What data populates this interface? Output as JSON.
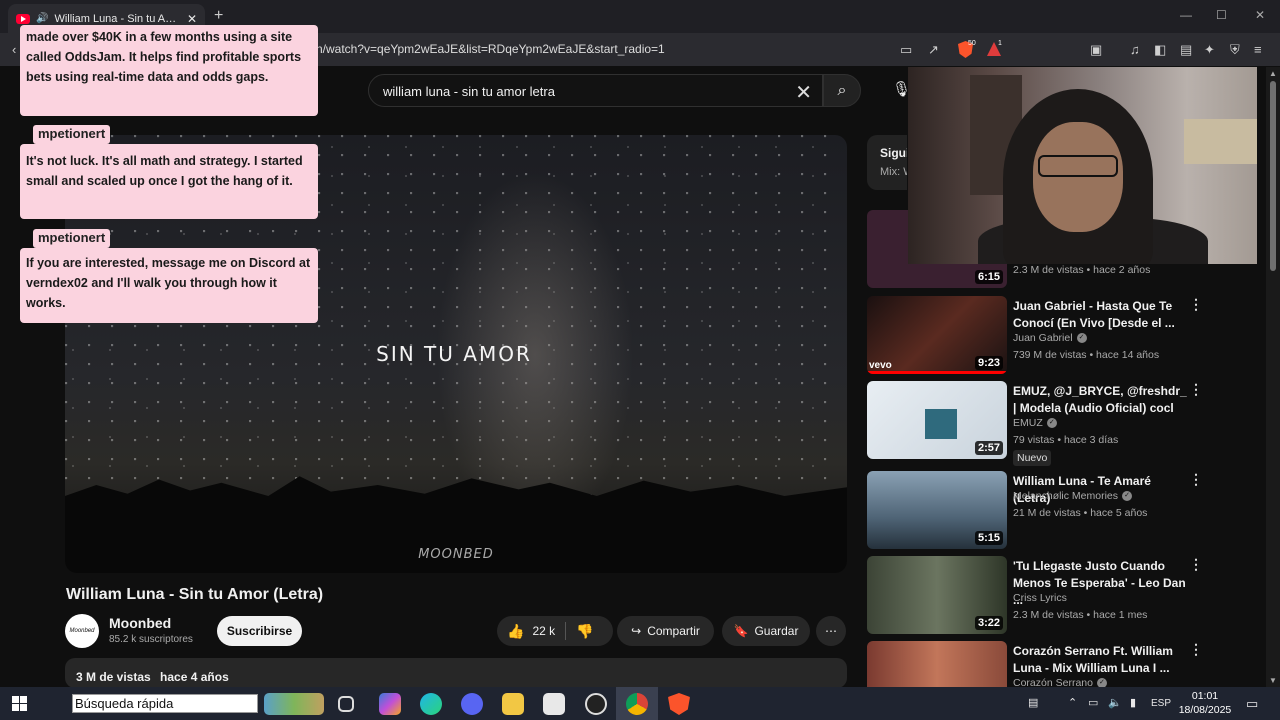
{
  "browser": {
    "tab_title": "William Luna - Sin tu Amor (Letra)",
    "url": "n/watch?v=qeYpm2wEaJE&list=RDqeYpm2wEaJE&start_radio=1",
    "shield_count": "50",
    "alert_count": "1"
  },
  "search": {
    "query": "william luna - sin tu amor letra"
  },
  "player": {
    "lyric": "SIN TU AMOR",
    "watermark": "MOONBED"
  },
  "chat": {
    "messages": [
      {
        "author": "",
        "text": "made over $40K in a few months using a site called OddsJam. It helps find profitable sports bets using real-time data and odds gaps."
      },
      {
        "author": "mpetionert",
        "text": "It's not luck. It's all math and strategy. I started small and scaled up once I got the hang of it."
      },
      {
        "author": "mpetionert",
        "text": "If you are interested, message me on Discord at verndex02 and I'll walk you through how it works."
      }
    ]
  },
  "video": {
    "title": "William Luna - Sin tu Amor (Letra)",
    "channel": "Moonbed",
    "avatar_text": "Moonbed",
    "subscribers": "85.2 k suscriptores",
    "subscribe_label": "Suscribirse",
    "likes": "22 k",
    "share_label": "Compartir",
    "save_label": "Guardar",
    "views": "3 M de vistas",
    "age": "hace 4 años"
  },
  "sidebar": {
    "mix_title": "Siguiente",
    "mix_sub": "Mix: W",
    "items": [
      {
        "title": "",
        "channel": "",
        "meta": "2.3 M de vistas • hace 2 años",
        "duration": "6:15",
        "thumb": "#3a2030"
      },
      {
        "title": "Juan Gabriel - Hasta Que Te Conocí (En Vivo [Desde el ...",
        "channel": "Juan Gabriel",
        "meta": "739 M de vistas • hace 14 años",
        "duration": "9:23",
        "thumb": "#3b1e18"
      },
      {
        "title": "EMUZ, @J_BRYCE, @freshdr_ | Modela (Audio Oficial) cocl",
        "channel": "EMUZ",
        "meta": "79 vistas • hace 3 días",
        "duration": "2:57",
        "thumb": "#c9d3dc",
        "badge": "Nuevo"
      },
      {
        "title": "William Luna - Te Amaré (Letra)",
        "channel": "Melanchølic Memories",
        "meta": "21 M de vistas • hace 5 años",
        "duration": "5:15",
        "thumb": "#5c7186"
      },
      {
        "title": "'Tu Llegaste Justo Cuando Menos Te Esperaba' - Leo Dan ...",
        "channel": "Criss Lyrics",
        "meta": "2.3 M de vistas • hace 1 mes",
        "duration": "3:22",
        "thumb": "#4e5a48"
      },
      {
        "title": "Corazón Serrano Ft. William Luna - Mix William Luna I ...",
        "channel": "Corazón Serrano",
        "meta": "",
        "duration": "",
        "thumb": "#b36050"
      }
    ]
  },
  "taskbar": {
    "search_placeholder": "Búsqueda rápida",
    "lang": "ESP",
    "time": "01:01",
    "date": "18/08/2025"
  }
}
